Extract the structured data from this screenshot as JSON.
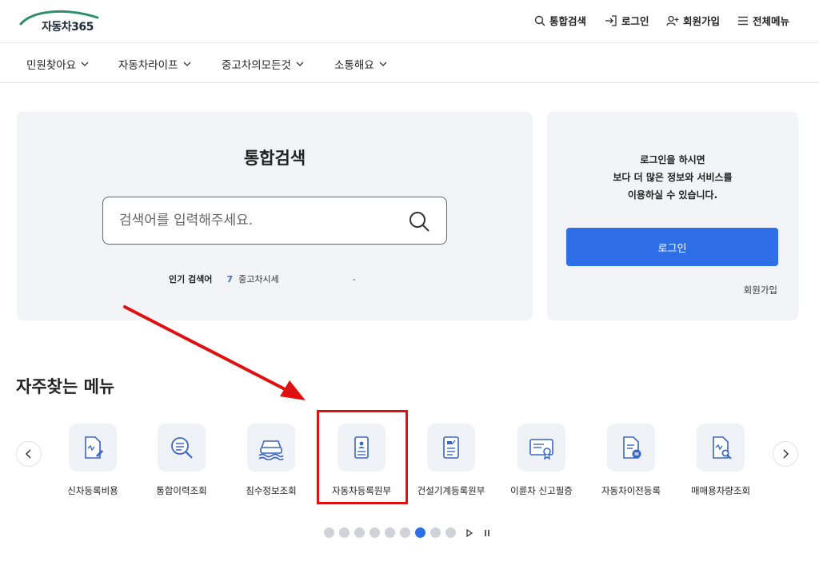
{
  "header": {
    "logo_text": "자동차365",
    "utils": [
      {
        "label": "통합검색",
        "icon": "search-icon"
      },
      {
        "label": "로그인",
        "icon": "login-icon"
      },
      {
        "label": "회원가입",
        "icon": "user-add-icon"
      },
      {
        "label": "전체메뉴",
        "icon": "menu-icon"
      }
    ]
  },
  "nav": {
    "items": [
      {
        "label": "민원찾아요",
        "icon": "chevron-down-icon"
      },
      {
        "label": "자동차라이프",
        "icon": "chevron-down-icon"
      },
      {
        "label": "중고차의모든것",
        "icon": "chevron-down-icon"
      },
      {
        "label": "소통해요",
        "icon": "chevron-down-icon"
      }
    ]
  },
  "search": {
    "title": "통합검색",
    "placeholder": "검색어를 입력해주세요.",
    "popular_label": "인기 검색어",
    "popular_rank": "7",
    "popular_term": "중고차시세",
    "popular_dash": "-"
  },
  "login": {
    "message_lines": [
      "로그인을 하시면",
      "보다 더 많은 정보와 서비스를",
      "이용하실 수 있습니다."
    ],
    "button_label": "로그인",
    "join_label": "회원가입"
  },
  "frequent": {
    "title": "자주찾는 메뉴",
    "items": [
      {
        "label": "신차등록비용",
        "icon": "document-pen-icon"
      },
      {
        "label": "통합이력조회",
        "icon": "magnifier-list-icon"
      },
      {
        "label": "침수정보조회",
        "icon": "flooded-car-icon"
      },
      {
        "label": "자동차등록원부",
        "icon": "registration-card-icon"
      },
      {
        "label": "건설기계등록원부",
        "icon": "machinery-document-icon"
      },
      {
        "label": "이륜차 신고필증",
        "icon": "certificate-icon"
      },
      {
        "label": "자동차이전등록",
        "icon": "transfer-document-icon"
      },
      {
        "label": "매매용차량조회",
        "icon": "document-search-icon"
      }
    ],
    "prev_icon": "chevron-left-icon",
    "next_icon": "chevron-right-icon"
  },
  "pager": {
    "total": 9,
    "active_index": 6,
    "play_icon": "play-icon",
    "pause_icon": "pause-icon"
  },
  "annotation": {
    "arrow_color": "#e01010",
    "box_color": "#e01010"
  },
  "colors": {
    "accent": "#2e6ee6",
    "panel_bg": "#f1f3f6",
    "logo_green": "#2f8f6b"
  }
}
